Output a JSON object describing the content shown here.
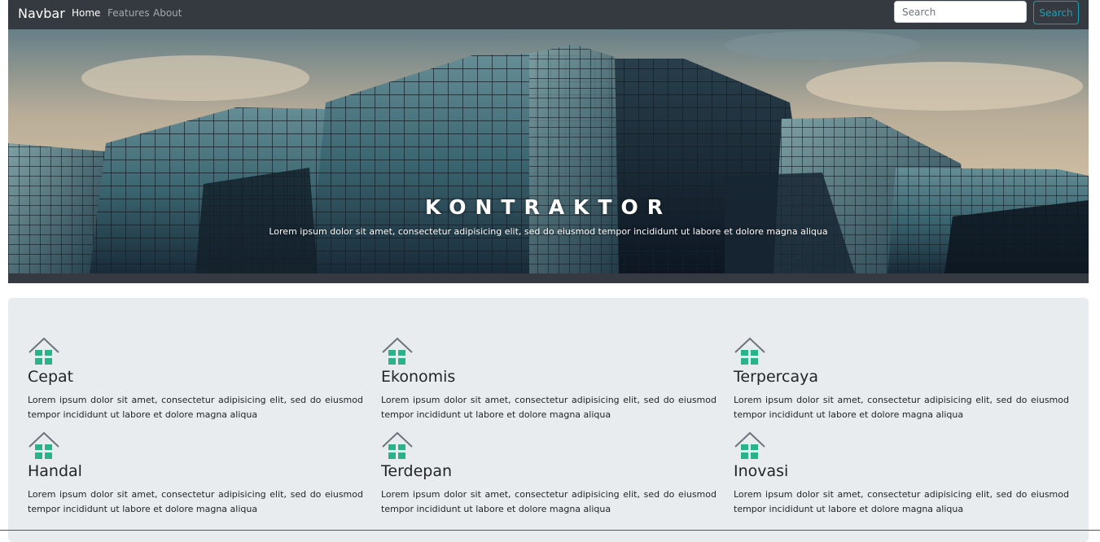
{
  "navbar": {
    "brand": "Navbar",
    "links": [
      {
        "label": "Home",
        "active": true
      },
      {
        "label": "Features",
        "active": false
      },
      {
        "label": "About",
        "active": false
      }
    ],
    "search_placeholder": "Search",
    "search_button": "Search"
  },
  "hero": {
    "title": "KONTRAKTOR",
    "subtitle": "Lorem ipsum dolor sit amet, consectetur adipisicing elit, sed do eiusmod tempor incididunt ut labore et dolore magna aliqua"
  },
  "features": [
    {
      "icon": "house-icon",
      "title": "Cepat",
      "text": "Lorem ipsum dolor sit amet, consectetur adipisicing elit, sed do eiusmod tempor incididunt ut labore et dolore magna aliqua"
    },
    {
      "icon": "house-icon",
      "title": "Ekonomis",
      "text": "Lorem ipsum dolor sit amet, consectetur adipisicing elit, sed do eiusmod tempor incididunt ut labore et dolore magna aliqua"
    },
    {
      "icon": "house-icon",
      "title": "Terpercaya",
      "text": "Lorem ipsum dolor sit amet, consectetur adipisicing elit, sed do eiusmod tempor incididunt ut labore et dolore magna aliqua"
    },
    {
      "icon": "house-icon",
      "title": "Handal",
      "text": "Lorem ipsum dolor sit amet, consectetur adipisicing elit, sed do eiusmod tempor incididunt ut labore et dolore magna aliqua"
    },
    {
      "icon": "house-icon",
      "title": "Terdepan",
      "text": "Lorem ipsum dolor sit amet, consectetur adipisicing elit, sed do eiusmod tempor incididunt ut labore et dolore magna aliqua"
    },
    {
      "icon": "house-icon",
      "title": "Inovasi",
      "text": "Lorem ipsum dolor sit amet, consectetur adipisicing elit, sed do eiusmod tempor incididunt ut labore et dolore magna aliqua"
    }
  ],
  "colors": {
    "navbar_bg": "#343a40",
    "accent": "#17a2b8",
    "features_bg": "#e9ecef",
    "icon_green": "#2ab38a"
  }
}
